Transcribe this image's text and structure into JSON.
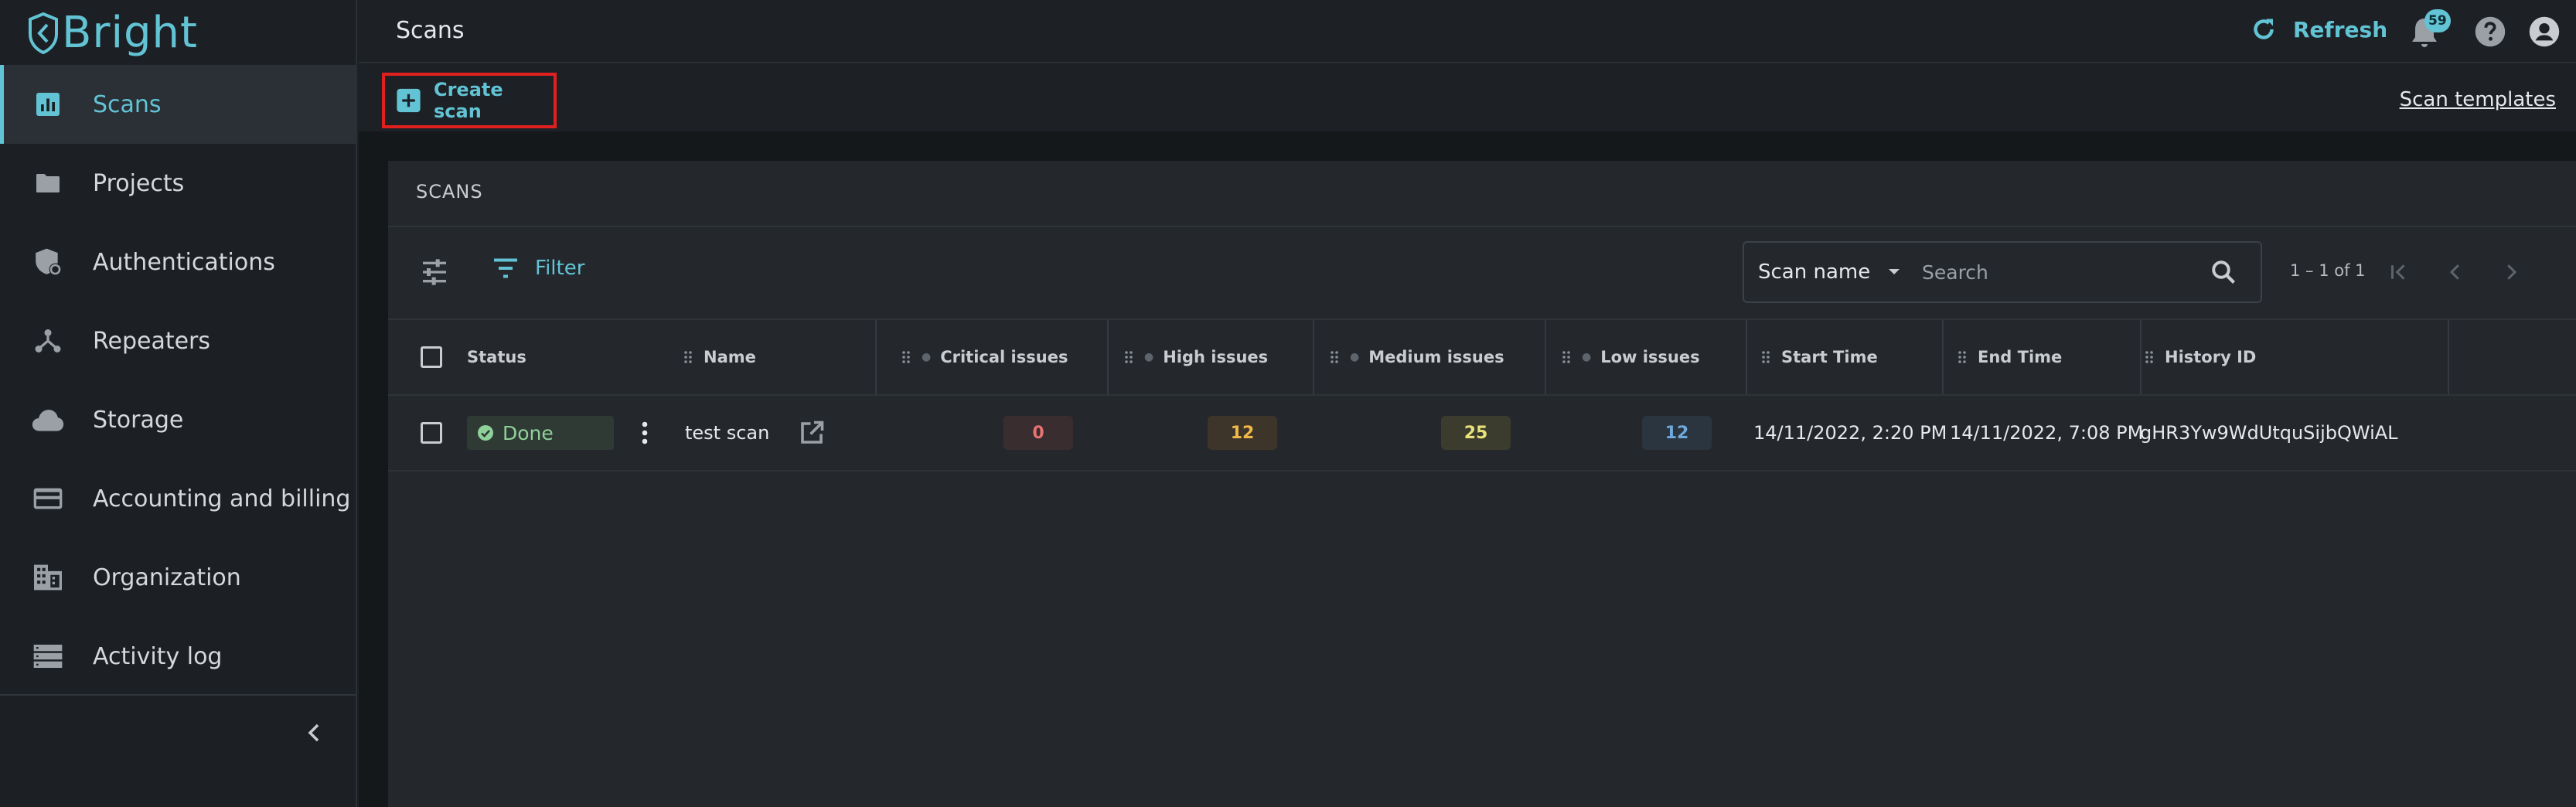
{
  "app": {
    "logo_text": "Bright"
  },
  "sidebar": {
    "items": [
      {
        "label": "Scans",
        "icon": "bar-chart-icon",
        "active": true
      },
      {
        "label": "Projects",
        "icon": "folder-icon"
      },
      {
        "label": "Authentications",
        "icon": "shield-icon"
      },
      {
        "label": "Repeaters",
        "icon": "hub-icon"
      },
      {
        "label": "Storage",
        "icon": "cloud-icon"
      },
      {
        "label": "Accounting and billing",
        "icon": "credit-card-icon"
      },
      {
        "label": "Organization",
        "icon": "building-icon"
      },
      {
        "label": "Activity log",
        "icon": "list-icon"
      }
    ]
  },
  "header": {
    "title": "Scans",
    "refresh_label": "Refresh",
    "notification_count": "59"
  },
  "actions": {
    "create_scan_label": "Create scan",
    "scan_templates_label": "Scan templates"
  },
  "scans_card": {
    "title": "SCANS",
    "filter_label": "Filter",
    "search_by": "Scan name",
    "search_placeholder": "Search",
    "pager_text": "1 – 1 of 1",
    "columns": [
      "Status",
      "Name",
      "Critical issues",
      "High issues",
      "Medium issues",
      "Low issues",
      "Start Time",
      "End Time",
      "History ID"
    ],
    "rows": [
      {
        "status": "Done",
        "name": "test scan",
        "critical": "0",
        "high": "12",
        "medium": "25",
        "low": "12",
        "start_time": "14/11/2022, 2:20 PM",
        "end_time": "14/11/2022, 7:08 PM",
        "history_id": "gHR3Yw9WdUtquSijbQWiAL"
      }
    ]
  },
  "colors": {
    "accent": "#62c3d4",
    "critical": "#e57373",
    "high": "#f0b84a",
    "medium": "#e8e27a",
    "low": "#6fa8dc",
    "status_done": "#8fd19a",
    "highlight_box": "#e0201f"
  }
}
